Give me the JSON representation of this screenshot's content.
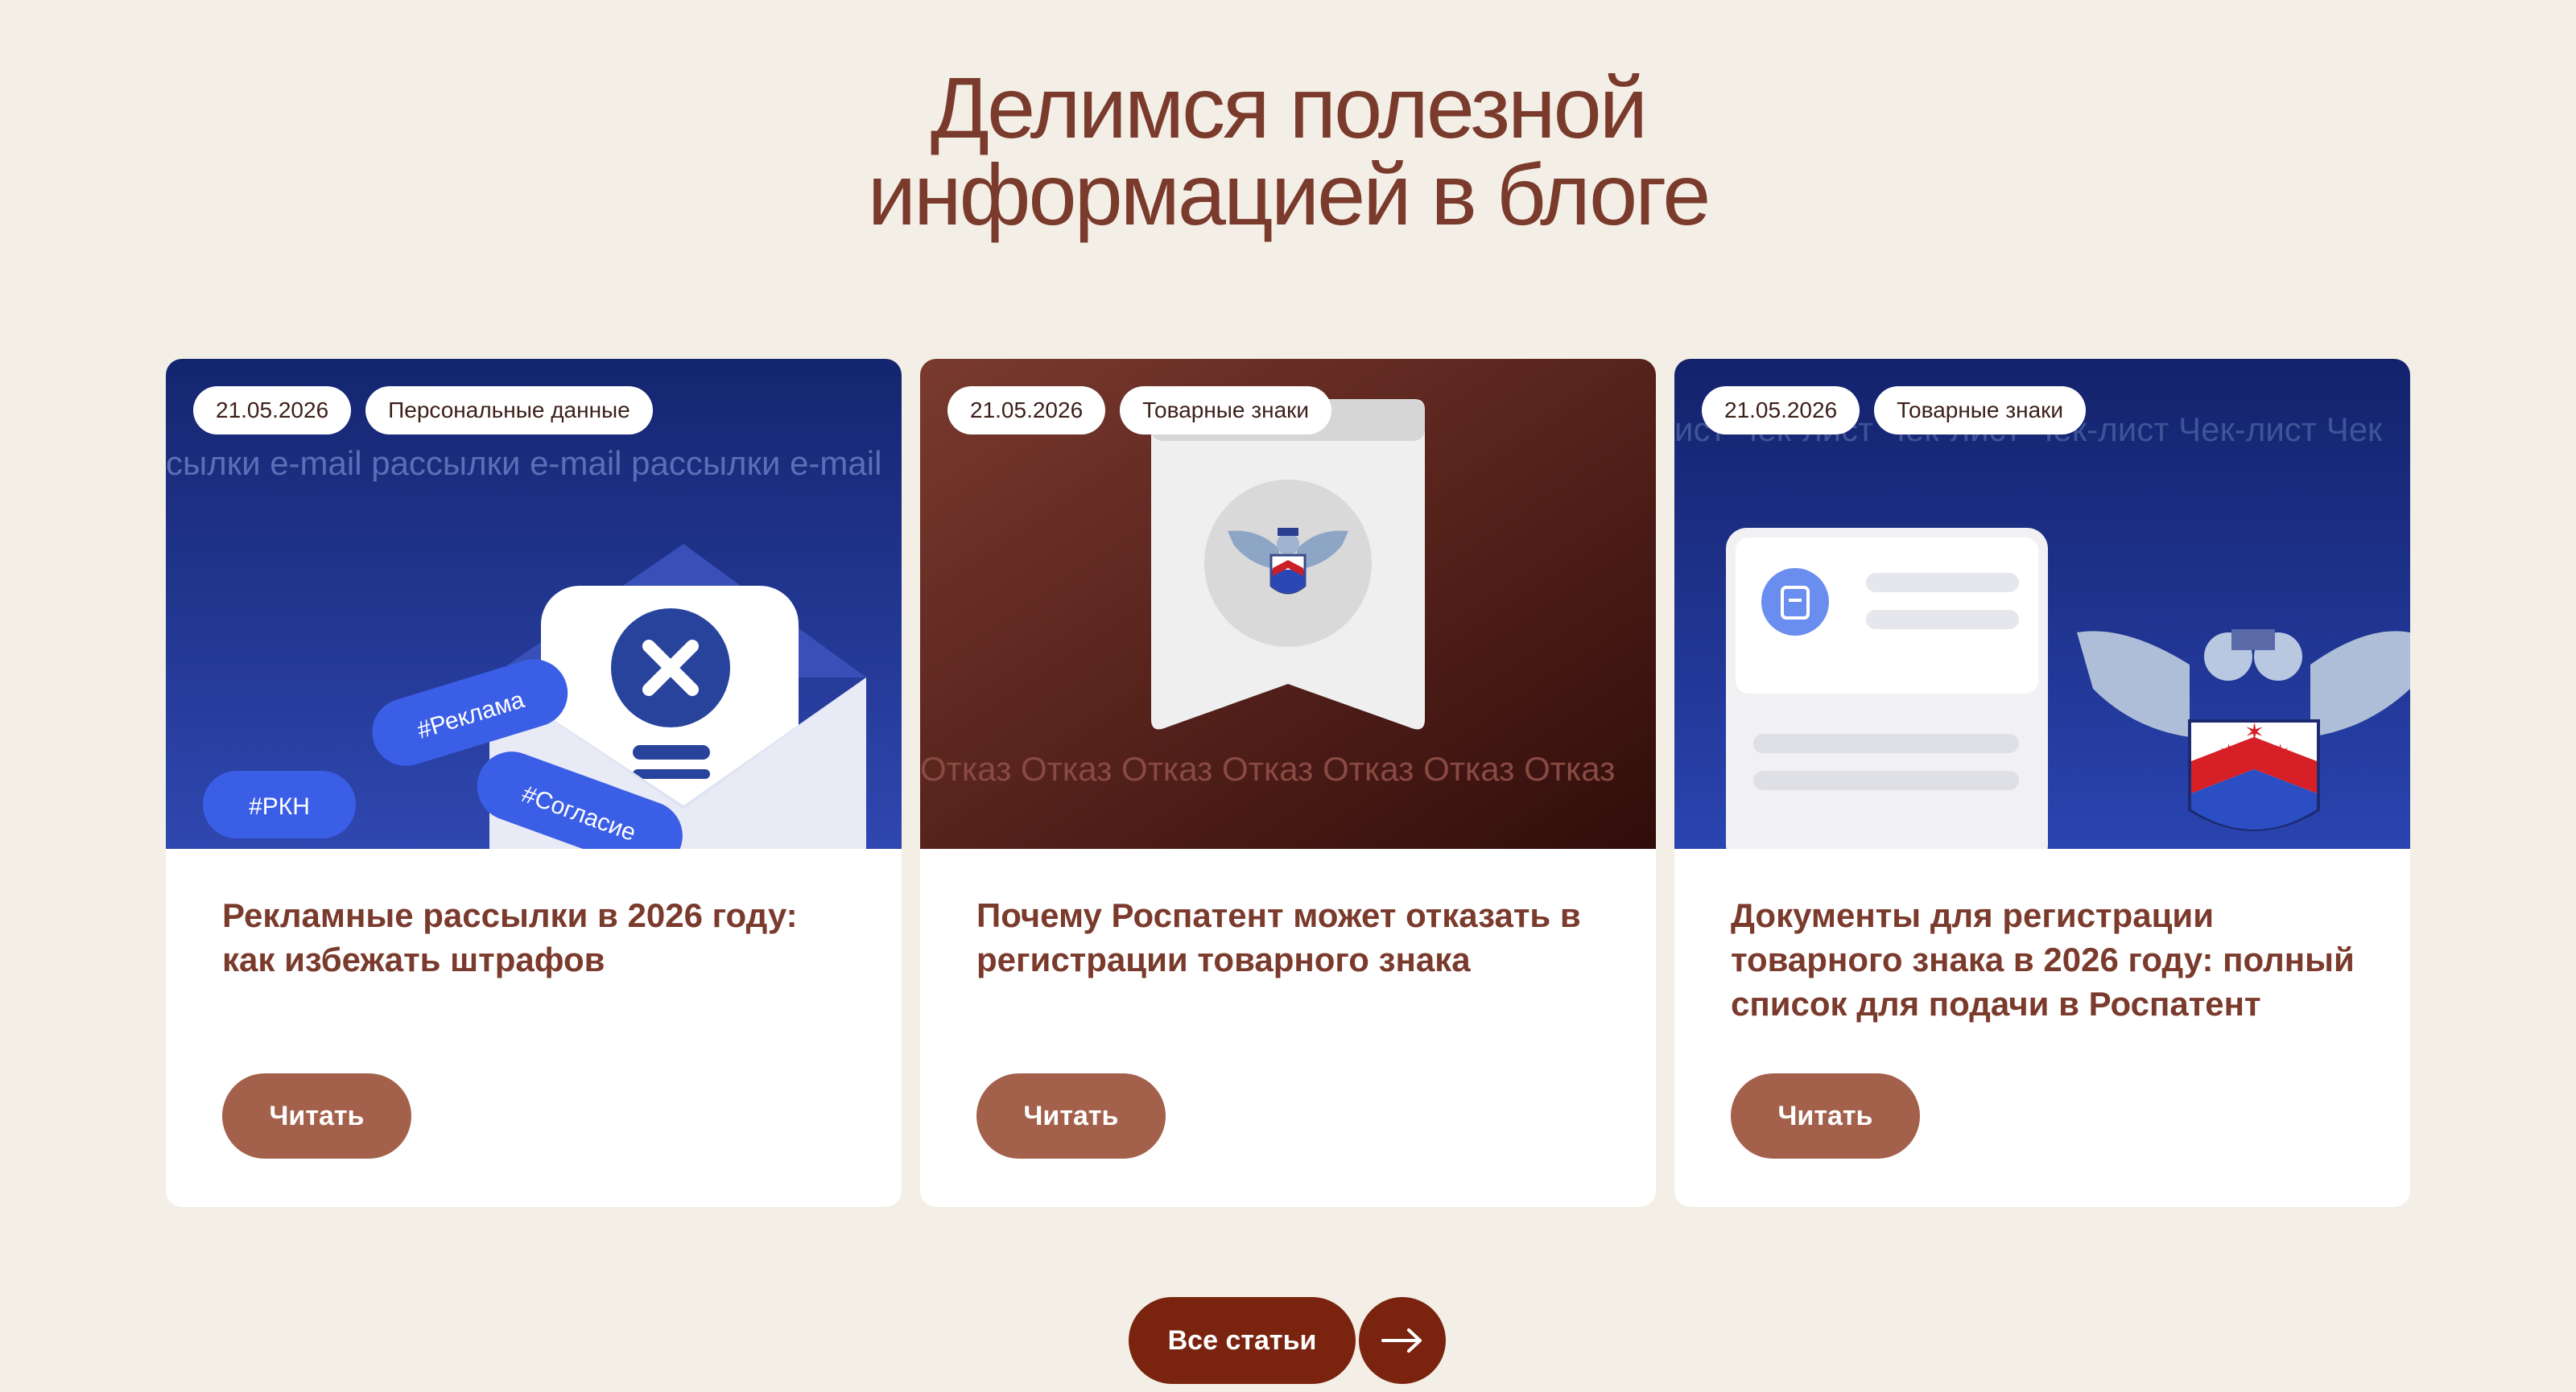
{
  "heading": {
    "line1": "Делимся полезной",
    "line2": "информацией в блоге"
  },
  "cards": [
    {
      "date": "21.05.2026",
      "category": "Персональные данные",
      "ticker": "сылки  e-mail рассылки  e-mail рассылки  e-mail",
      "badges": [
        "#Реклама",
        "#Согласие",
        "#РКН"
      ],
      "title": "Рекламные рассылки в 2026 году: как избежать штрафов",
      "button": "Читать"
    },
    {
      "date": "21.05.2026",
      "category": "Товарные знаки",
      "ticker": "Отказ  Отказ  Отказ  Отказ  Отказ  Отказ  Отказ",
      "title": "Почему Роспатент может отказать в регистрации товарного знака",
      "button": "Читать"
    },
    {
      "date": "21.05.2026",
      "category": "Товарные знаки",
      "ticker": "ист  Чек-лист  Чек-лист  Чек-лист  Чек-лист  Чек",
      "title": "Документы для регистрации товарного знака в 2026 году: полный список для подачи в Роспатент",
      "button": "Читать"
    }
  ],
  "all_articles": {
    "label": "Все статьи",
    "icon": "arrow-right-icon"
  },
  "colors": {
    "background": "#f3efe6",
    "heading": "#7a3a2c",
    "read_button": "#a3614c",
    "all_button": "#7a2410"
  }
}
